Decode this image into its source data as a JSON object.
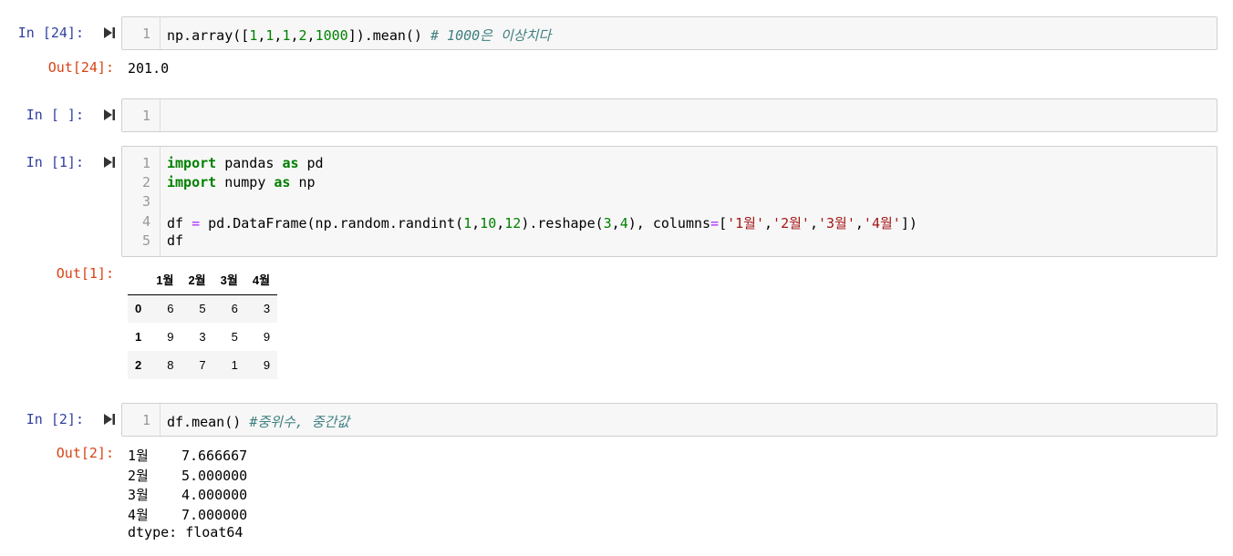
{
  "cells": [
    {
      "in_prompt": "In [24]:",
      "lines": [
        {
          "n": "1",
          "tokens": [
            {
              "t": "np.array([",
              "c": ""
            },
            {
              "t": "1",
              "c": "num"
            },
            {
              "t": ",",
              "c": ""
            },
            {
              "t": "1",
              "c": "num"
            },
            {
              "t": ",",
              "c": ""
            },
            {
              "t": "1",
              "c": "num"
            },
            {
              "t": ",",
              "c": ""
            },
            {
              "t": "2",
              "c": "num"
            },
            {
              "t": ",",
              "c": ""
            },
            {
              "t": "1000",
              "c": "num"
            },
            {
              "t": "]).mean() ",
              "c": ""
            },
            {
              "t": "# 1000은 이상치다",
              "c": "cmt"
            }
          ]
        }
      ],
      "out_prompt": "Out[24]:",
      "output_text": "201.0"
    },
    {
      "in_prompt": "In [ ]:",
      "lines": [
        {
          "n": "1",
          "tokens": []
        }
      ]
    },
    {
      "in_prompt": "In [1]:",
      "lines": [
        {
          "n": "1",
          "tokens": [
            {
              "t": "import",
              "c": "kw"
            },
            {
              "t": " pandas ",
              "c": ""
            },
            {
              "t": "as",
              "c": "kw"
            },
            {
              "t": " pd",
              "c": ""
            }
          ]
        },
        {
          "n": "2",
          "tokens": [
            {
              "t": "import",
              "c": "kw"
            },
            {
              "t": " numpy ",
              "c": ""
            },
            {
              "t": "as",
              "c": "kw"
            },
            {
              "t": " np",
              "c": ""
            }
          ]
        },
        {
          "n": "3",
          "tokens": []
        },
        {
          "n": "4",
          "tokens": [
            {
              "t": "df ",
              "c": ""
            },
            {
              "t": "=",
              "c": "op"
            },
            {
              "t": " pd.DataFrame(np.random.randint(",
              "c": ""
            },
            {
              "t": "1",
              "c": "num"
            },
            {
              "t": ",",
              "c": ""
            },
            {
              "t": "10",
              "c": "num"
            },
            {
              "t": ",",
              "c": ""
            },
            {
              "t": "12",
              "c": "num"
            },
            {
              "t": ").reshape(",
              "c": ""
            },
            {
              "t": "3",
              "c": "num"
            },
            {
              "t": ",",
              "c": ""
            },
            {
              "t": "4",
              "c": "num"
            },
            {
              "t": "), columns",
              "c": ""
            },
            {
              "t": "=",
              "c": "op"
            },
            {
              "t": "[",
              "c": ""
            },
            {
              "t": "'1월'",
              "c": "str"
            },
            {
              "t": ",",
              "c": ""
            },
            {
              "t": "'2월'",
              "c": "str"
            },
            {
              "t": ",",
              "c": ""
            },
            {
              "t": "'3월'",
              "c": "str"
            },
            {
              "t": ",",
              "c": ""
            },
            {
              "t": "'4월'",
              "c": "str"
            },
            {
              "t": "])",
              "c": ""
            }
          ]
        },
        {
          "n": "5",
          "tokens": [
            {
              "t": "df",
              "c": ""
            }
          ]
        }
      ],
      "out_prompt": "Out[1]:",
      "dataframe": {
        "columns": [
          "1월",
          "2월",
          "3월",
          "4월"
        ],
        "rows": [
          {
            "index": "0",
            "values": [
              "6",
              "5",
              "6",
              "3"
            ]
          },
          {
            "index": "1",
            "values": [
              "9",
              "3",
              "5",
              "9"
            ]
          },
          {
            "index": "2",
            "values": [
              "8",
              "7",
              "1",
              "9"
            ]
          }
        ]
      }
    },
    {
      "in_prompt": "In [2]:",
      "lines": [
        {
          "n": "1",
          "tokens": [
            {
              "t": "df.mean() ",
              "c": ""
            },
            {
              "t": "#중위수, 중간값",
              "c": "cmt"
            }
          ]
        }
      ],
      "out_prompt": "Out[2]:",
      "output_lines": [
        "1월    7.666667",
        "2월    5.000000",
        "3월    4.000000",
        "4월    7.000000",
        "dtype: float64"
      ]
    }
  ],
  "icons": {
    "run": "run-cell-icon"
  }
}
